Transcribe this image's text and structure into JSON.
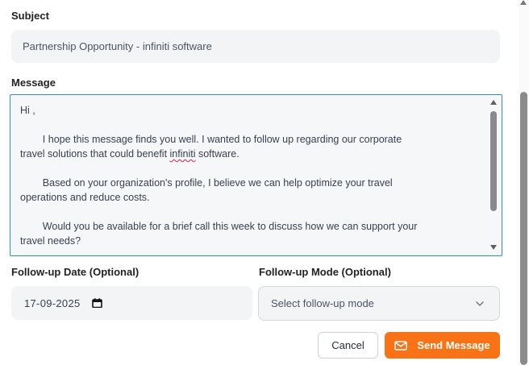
{
  "subject": {
    "label": "Subject",
    "value": "Partnership Opportunity - infiniti software"
  },
  "message": {
    "label": "Message",
    "greeting": "Hi ,",
    "p1_before": "        I hope this message finds you well. I wanted to follow up regarding our corporate\ntravel solutions that could benefit ",
    "p1_misspelled": "infiniti",
    "p1_after": " software.",
    "p2": "        Based on your organization's profile, I believe we can help optimize your travel\noperations and reduce costs.",
    "p3": "        Would you be available for a brief call this week to discuss how we can support your\ntravel needs?"
  },
  "followup_date": {
    "label": "Follow-up Date (Optional)",
    "value": "17-09-2025",
    "icon": "calendar-icon"
  },
  "followup_mode": {
    "label": "Follow-up Mode (Optional)",
    "placeholder": "Select follow-up mode",
    "icon": "chevron-down-icon"
  },
  "actions": {
    "cancel_label": "Cancel",
    "send_label": "Send Message",
    "send_icon": "mail-icon"
  },
  "colors": {
    "accent": "#f97316",
    "focus_border": "#2f8fd6",
    "field_bg": "#f3f4f6",
    "spell_underline": "#e11d48"
  }
}
